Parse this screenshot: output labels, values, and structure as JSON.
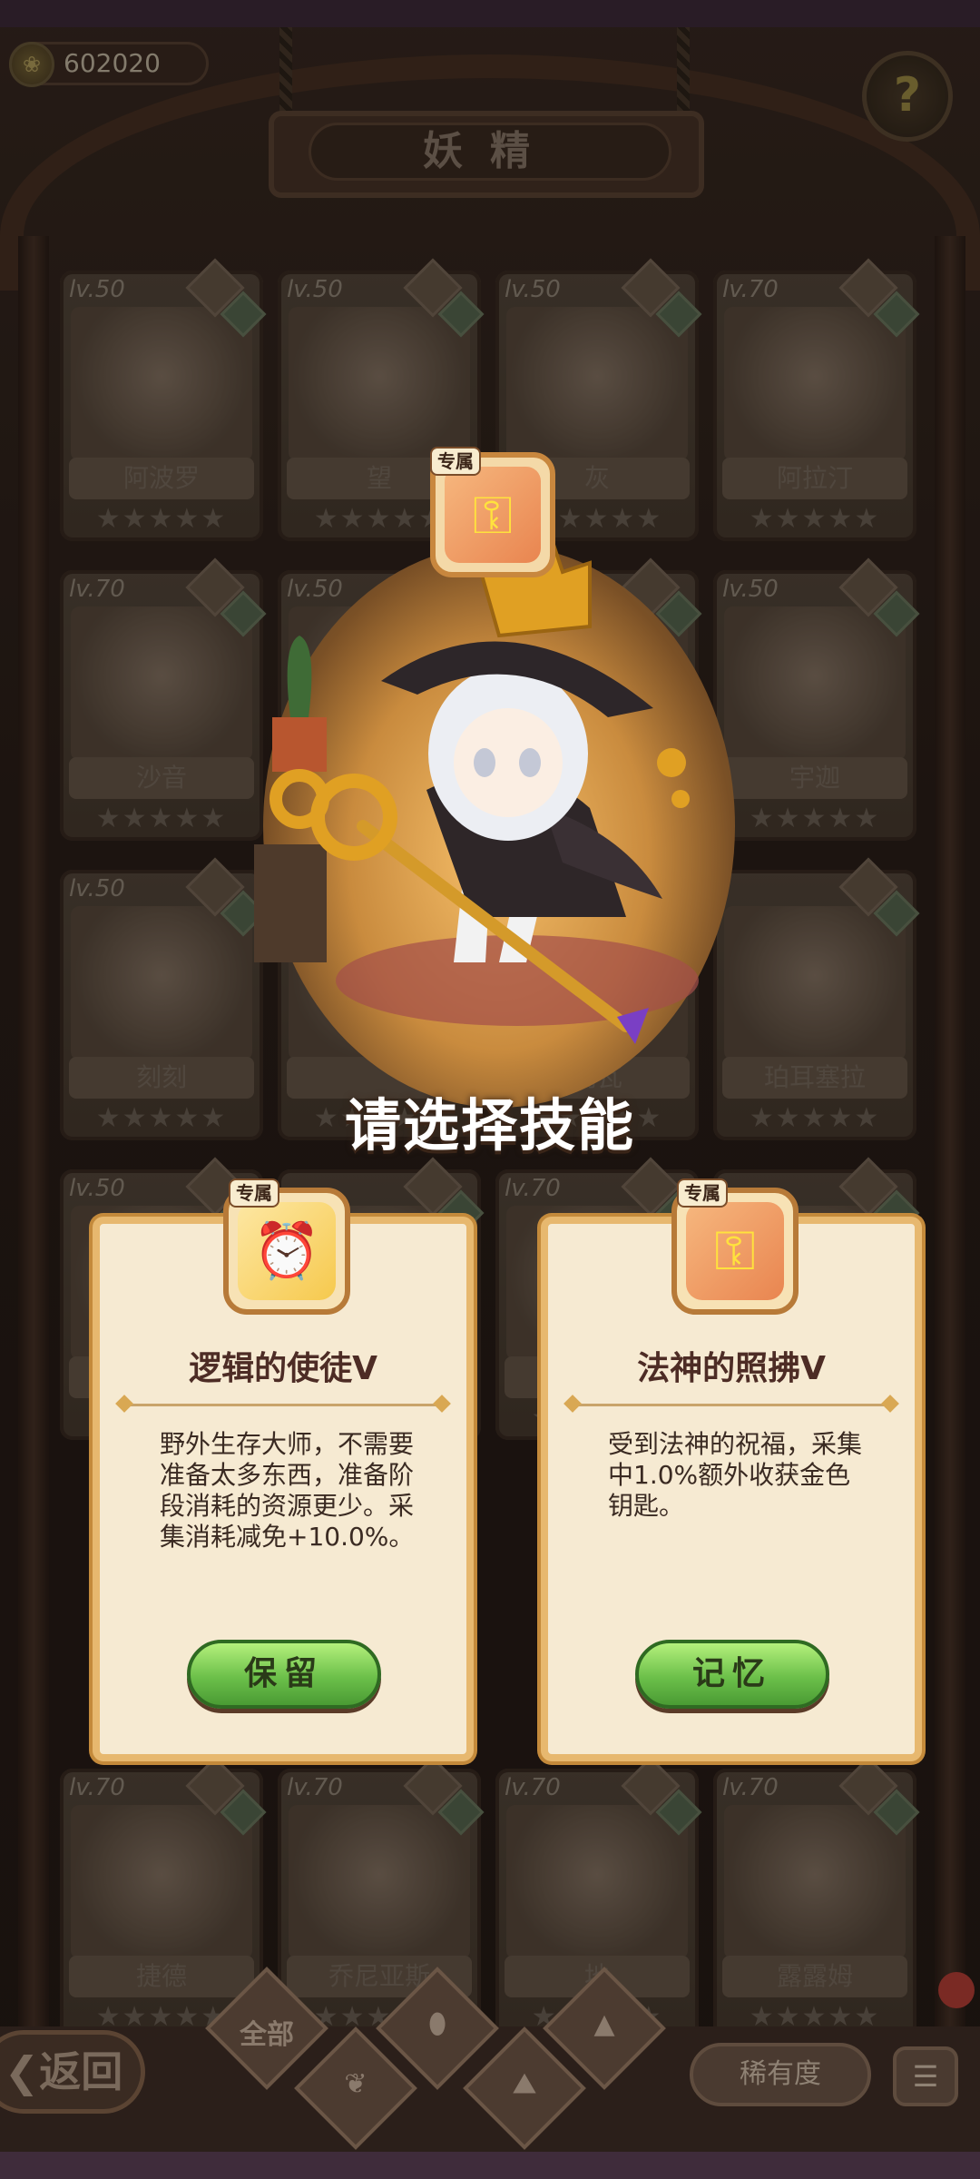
{
  "header": {
    "coin_count": "602020",
    "page_title": "妖精",
    "help_glyph": "?"
  },
  "cards": [
    {
      "level": "lv.50",
      "name": "阿波罗"
    },
    {
      "level": "lv.50",
      "name": "望"
    },
    {
      "level": "lv.50",
      "name": "灰"
    },
    {
      "level": "lv.70",
      "name": "阿拉汀"
    },
    {
      "level": "lv.70",
      "name": "沙音"
    },
    {
      "level": "lv.50",
      "name": ""
    },
    {
      "level": "",
      "name": ""
    },
    {
      "level": "lv.50",
      "name": "宇迦"
    },
    {
      "level": "lv.50",
      "name": "刻刻"
    },
    {
      "level": "",
      "name": ""
    },
    {
      "level": "",
      "name": "雨瓦"
    },
    {
      "level": "",
      "name": "珀耳塞拉"
    },
    {
      "level": "lv.50",
      "name": ""
    },
    {
      "level": "",
      "name": ""
    },
    {
      "level": "lv.70",
      "name": ""
    },
    {
      "level": "",
      "name": ""
    },
    {
      "level": "lv.70",
      "name": "捷德"
    },
    {
      "level": "lv.70",
      "name": "乔尼亚斯"
    },
    {
      "level": "lv.70",
      "name": "地"
    },
    {
      "level": "lv.70",
      "name": "露露姆"
    }
  ],
  "stars": "★★★★★",
  "overlay": {
    "exclusive_tag": "专属",
    "choose_title": "请选择技能",
    "skills": [
      {
        "tag": "专属",
        "icon": "alarm-clock-icon",
        "name": "逻辑的使徒V",
        "description": "野外生存大师，不需要准备太多东西，准备阶段消耗的资源更少。采集消耗减免+10.0%。",
        "button": "保留"
      },
      {
        "tag": "专属",
        "icon": "golden-key-icon",
        "name": "法神的照拂V",
        "description": "受到法神的祝福，采集中1.0%额外收获金色钥匙。",
        "button": "记忆"
      }
    ]
  },
  "bottom": {
    "back_label": "返回",
    "tab_all": "全部",
    "rarity_label": "稀有度",
    "sort_glyph": "☰"
  },
  "colors": {
    "accent_green": "#6cc04a",
    "card_border": "#e7b86f",
    "title_text": "#4d2c25"
  }
}
